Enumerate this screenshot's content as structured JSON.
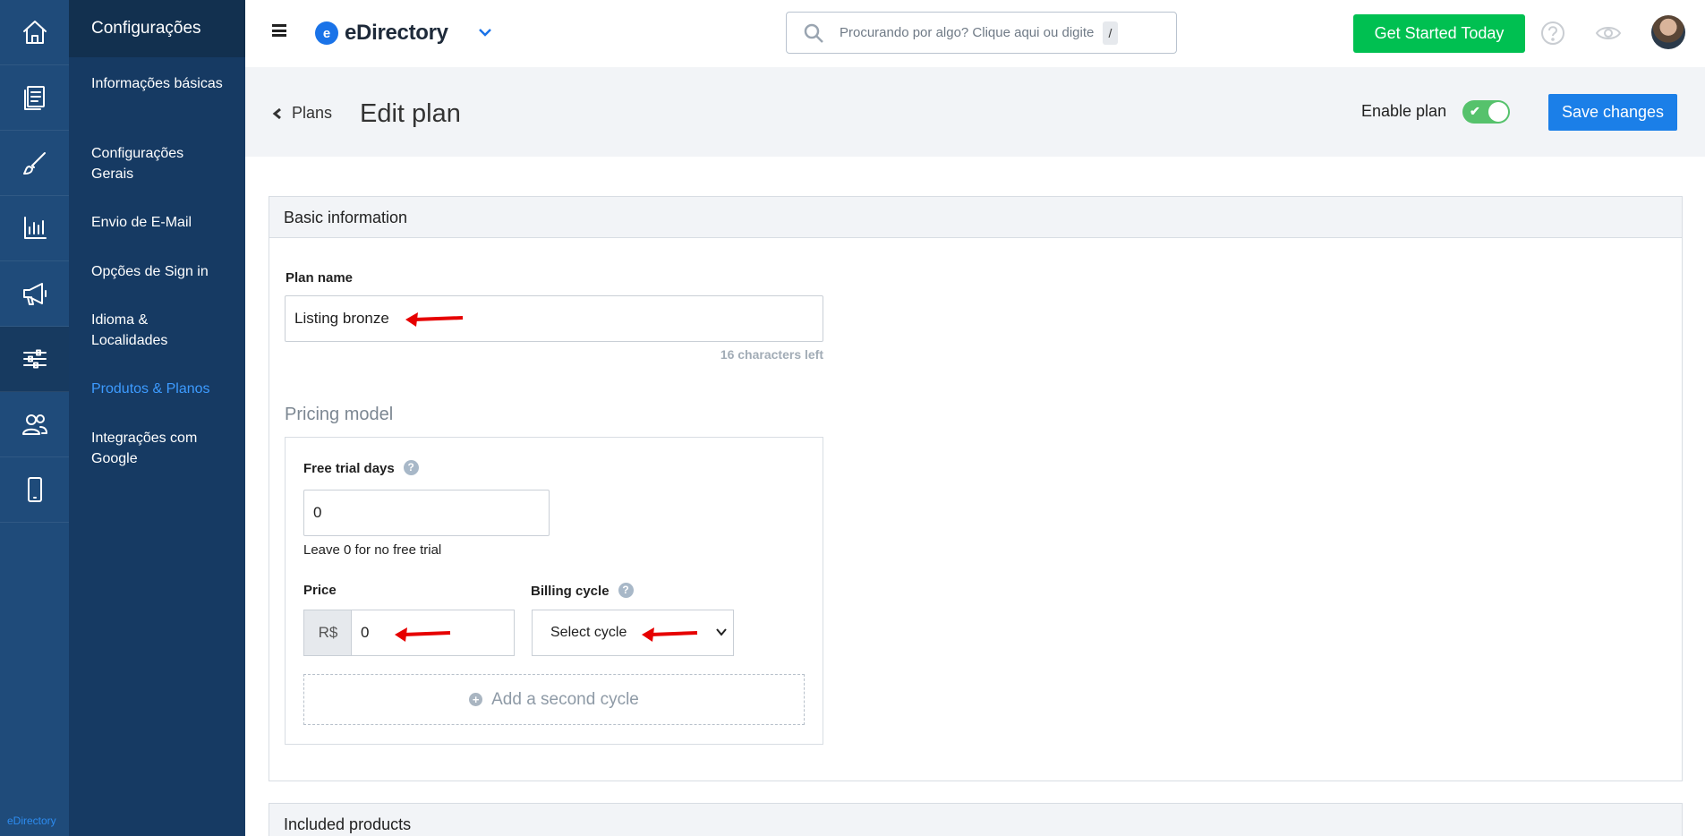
{
  "rail": {
    "brand": "eDirectory",
    "items": [
      {
        "icon": "home-icon"
      },
      {
        "icon": "content-icon"
      },
      {
        "icon": "design-brush-icon"
      },
      {
        "icon": "reports-chart-icon"
      },
      {
        "icon": "promote-megaphone-icon"
      },
      {
        "icon": "settings-sliders-icon",
        "active": true
      },
      {
        "icon": "users-icon"
      },
      {
        "icon": "mobile-icon"
      }
    ]
  },
  "menu": {
    "title": "Configurações",
    "items": [
      {
        "label": "Informações básicas"
      },
      {
        "label": "Configurações Gerais"
      },
      {
        "label": "Envio de E-Mail"
      },
      {
        "label": "Opções de Sign in"
      },
      {
        "label": "Idioma & Localidades"
      },
      {
        "label": "Produtos & Planos",
        "active": true
      },
      {
        "label": "Integrações com Google"
      }
    ]
  },
  "topbar": {
    "logo_letter": "e",
    "logo_text": "eDirectory",
    "search_placeholder": "Procurando por algo? Clique aqui ou digite",
    "search_shortcut": "/",
    "cta_label": "Get Started Today",
    "accent_green": "#00c051"
  },
  "header": {
    "back_label": "Plans",
    "title": "Edit plan",
    "enable_label": "Enable plan",
    "enable_checked": true,
    "save_label": "Save changes",
    "accent_blue": "#1b7fe8"
  },
  "basic_info": {
    "heading": "Basic information",
    "plan_name_label": "Plan name",
    "plan_name_value": "Listing bronze",
    "chars_left": "16 characters left",
    "pricing_title": "Pricing model",
    "free_trial_label": "Free trial days",
    "free_trial_value": "0",
    "free_trial_hint": "Leave 0 for no free trial",
    "price_label": "Price",
    "currency": "R$",
    "price_value": "0",
    "billing_label": "Billing cycle",
    "billing_value": "Select cycle",
    "add_cycle_label": "Add a second cycle"
  },
  "included": {
    "heading": "Included products"
  }
}
